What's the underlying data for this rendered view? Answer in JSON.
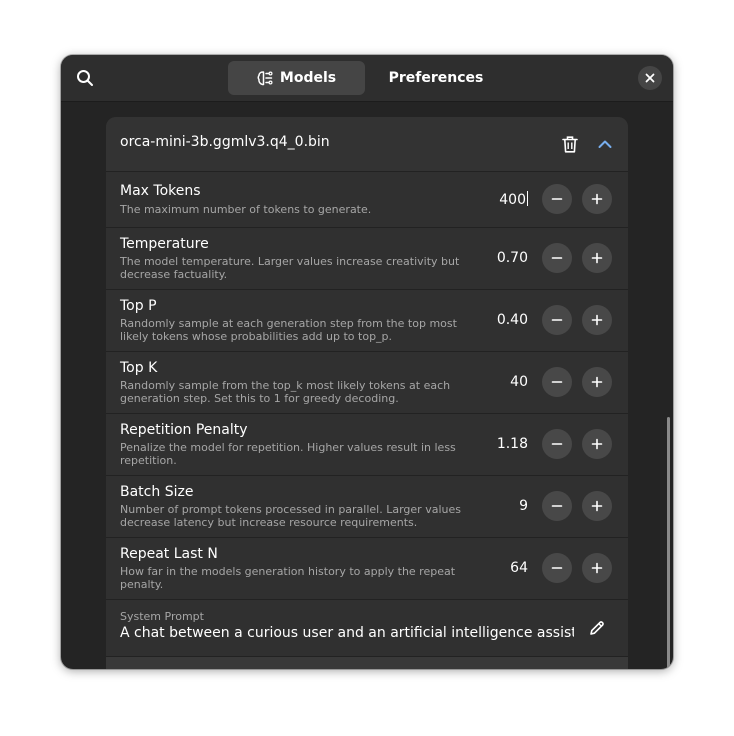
{
  "header": {
    "tabs": [
      {
        "label": "Models",
        "active": true,
        "icon": "brain-icon"
      },
      {
        "label": "Preferences",
        "active": false,
        "icon": "gear-icon"
      }
    ],
    "search_icon": "search-icon",
    "close_icon": "close-icon"
  },
  "model": {
    "name": "orca-mini-3b.ggmlv3.q4_0.bin",
    "expanded": true
  },
  "settings": [
    {
      "title": "Max Tokens",
      "description": "The maximum number of tokens to generate.",
      "value": "400",
      "editing": true
    },
    {
      "title": "Temperature",
      "description": "The model temperature. Larger values increase creativity but decrease factuality.",
      "value": "0.70"
    },
    {
      "title": "Top P",
      "description": "Randomly sample at each generation step from the top most likely tokens whose probabilities add up to top_p.",
      "value": "0.40"
    },
    {
      "title": "Top K",
      "description": "Randomly sample from the top_k most likely tokens at each generation step. Set this to 1 for greedy decoding.",
      "value": "40"
    },
    {
      "title": "Repetition Penalty",
      "description": "Penalize the model for repetition. Higher values result in less repetition.",
      "value": "1.18"
    },
    {
      "title": "Batch Size",
      "description": "Number of prompt tokens processed in parallel. Larger values decrease latency but increase resource requirements.",
      "value": "9"
    },
    {
      "title": "Repeat Last N",
      "description": "How far in the models generation history to apply the repeat penalty.",
      "value": "64"
    }
  ],
  "system_prompt": {
    "label": "System Prompt",
    "value": "A chat between a curious user and an artificial intelligence assistant"
  },
  "colors": {
    "window_bg": "#242424",
    "header_bg": "#2e2e2e",
    "card_bg": "#303030",
    "accent": "#78aeed",
    "button_bg": "#484848"
  }
}
